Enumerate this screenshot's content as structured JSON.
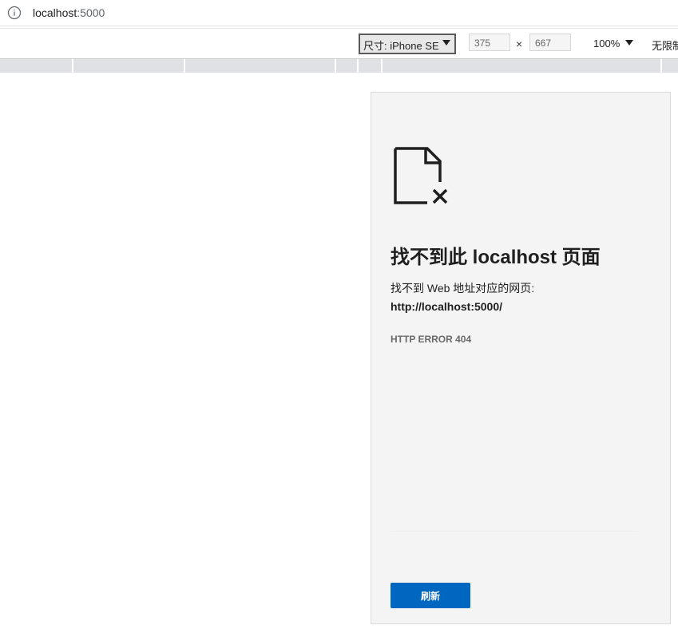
{
  "address_bar": {
    "host": "localhost",
    "port": ":5000"
  },
  "device_toolbar": {
    "device_label": "尺寸: iPhone SE",
    "width": "375",
    "height": "667",
    "dimension_separator": "×",
    "zoom": "100%",
    "throttling": "无限制"
  },
  "page": {
    "title": "找不到此 localhost 页面",
    "description": "找不到 Web 地址对应的网页:",
    "url": "http://localhost:5000/",
    "error_code": "HTTP ERROR 404",
    "reload_button": "刷新"
  },
  "colors": {
    "accent": "#0067c0",
    "viewport_bg": "#f4f4f4",
    "ruler": "#dfe1e5"
  },
  "icons": [
    "info-icon",
    "page-not-found-icon",
    "dropdown-caret-icon"
  ]
}
